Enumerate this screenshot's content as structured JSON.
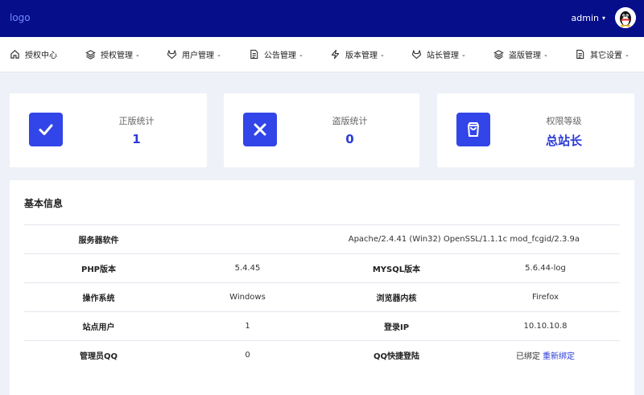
{
  "header": {
    "logo_text": "logo",
    "username": "admin",
    "avatar_icon": "qq-penguin-avatar"
  },
  "nav": {
    "items": [
      {
        "label": "授权中心",
        "icon": "home-icon",
        "dropdown": false
      },
      {
        "label": "授权管理",
        "icon": "layers-icon",
        "dropdown": true
      },
      {
        "label": "用户管理",
        "icon": "gitlab-icon",
        "dropdown": true
      },
      {
        "label": "公告管理",
        "icon": "document-icon",
        "dropdown": true
      },
      {
        "label": "版本管理",
        "icon": "lightning-icon",
        "dropdown": true
      },
      {
        "label": "站长管理",
        "icon": "gitlab-icon",
        "dropdown": true
      },
      {
        "label": "盗版管理",
        "icon": "layers-icon",
        "dropdown": true
      },
      {
        "label": "其它设置",
        "icon": "document-icon",
        "dropdown": true
      }
    ]
  },
  "cards": [
    {
      "label": "正版统计",
      "value": "1",
      "icon": "check-icon"
    },
    {
      "label": "盗版统计",
      "value": "0",
      "icon": "close-icon"
    },
    {
      "label": "权限等级",
      "value": "总站长",
      "icon": "shopping-bag-icon"
    }
  ],
  "info": {
    "title": "基本信息",
    "server_label": "服务器软件",
    "server_value": "Apache/2.4.41 (Win32) OpenSSL/1.1.1c mod_fcgid/2.3.9a",
    "rows": [
      {
        "k1": "PHP版本",
        "v1": "5.4.45",
        "k2": "MYSQL版本",
        "v2": "5.6.44-log"
      },
      {
        "k1": "操作系统",
        "v1": "Windows",
        "k2": "浏览器内核",
        "v2": "Firefox"
      },
      {
        "k1": "站点用户",
        "v1": "1",
        "k2": "登录IP",
        "v2": "10.10.10.8"
      },
      {
        "k1": "管理员QQ",
        "v1": "0",
        "k2": "QQ快捷登陆",
        "v2": "已绑定"
      }
    ],
    "rebind_link": "重新绑定"
  },
  "colors": {
    "topbar": "#070e8a",
    "accent": "#3245e8",
    "value_text": "#2b3bd6"
  }
}
